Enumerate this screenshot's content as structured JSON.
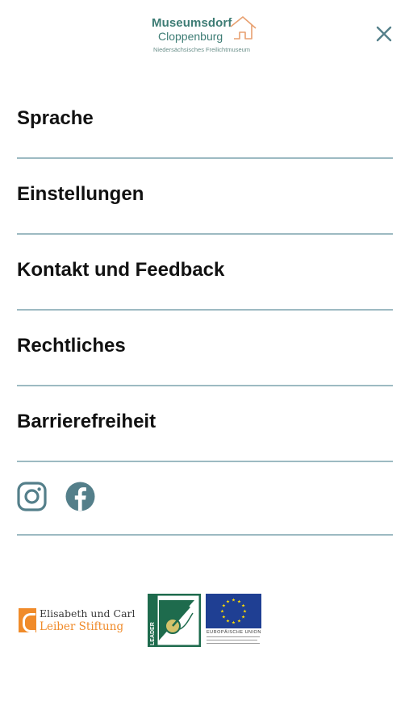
{
  "header": {
    "logo": {
      "line1": "Museumsdorf",
      "line2": "Cloppenburg",
      "tagline": "Niedersächsisches Freilichtmuseum"
    },
    "close_icon": "close-icon"
  },
  "menu": {
    "items": [
      {
        "label": "Sprache"
      },
      {
        "label": "Einstellungen"
      },
      {
        "label": "Kontakt und Feedback"
      },
      {
        "label": "Rechtliches"
      },
      {
        "label": "Barrierefreiheit"
      }
    ]
  },
  "social": {
    "icons": [
      "instagram-icon",
      "facebook-icon"
    ]
  },
  "partners": {
    "leiber": {
      "line1": "Elisabeth und Carl",
      "line2": "Leiber Stiftung"
    },
    "leader": {
      "text": "LEADER"
    },
    "eu": {
      "caption": "EUROPÄISCHE UNION"
    }
  },
  "colors": {
    "accent": "#3d7c74",
    "divider": "#9dbac2",
    "icon": "#547f8a",
    "orange": "#f08b2a",
    "leader_green": "#1e6b4d",
    "eu_blue": "#1f3f93",
    "eu_star": "#ffdd00"
  }
}
